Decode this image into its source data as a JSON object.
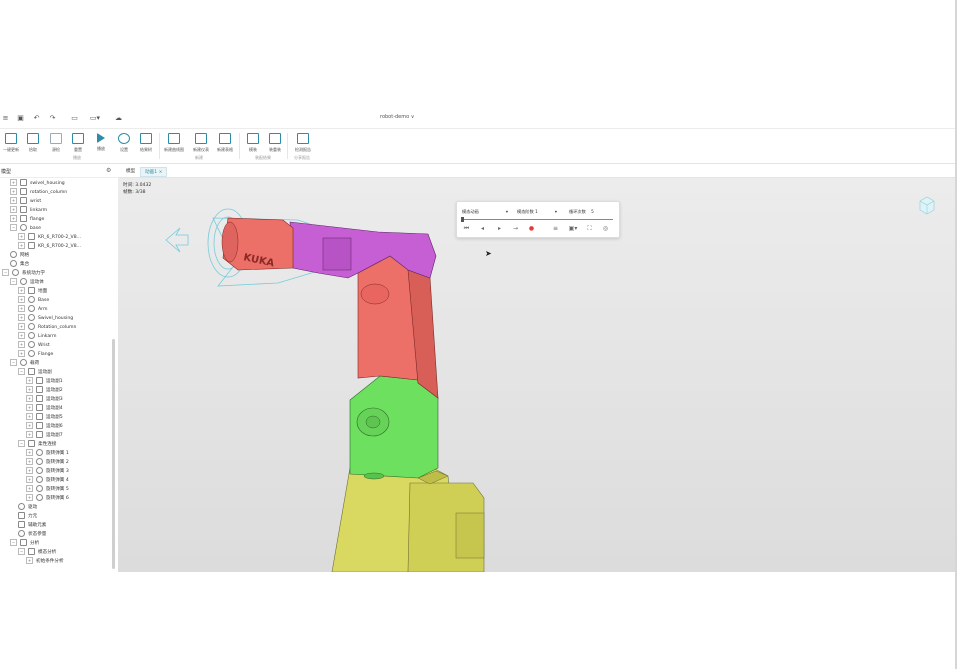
{
  "document": {
    "title": "robot-demo",
    "dropdown_icon": "chevron-down-icon"
  },
  "titlebar_icons": [
    "menu-icon",
    "save-icon",
    "undo-icon",
    "redo-icon",
    "screen-icon",
    "layout-icon",
    "cloud-icon"
  ],
  "ribbon": {
    "buttons": [
      {
        "label": "一键更新",
        "icon": "refresh-icon"
      },
      {
        "label": "拾取",
        "icon": "pick-icon"
      },
      {
        "label": "源检",
        "icon": "check-icon"
      },
      {
        "label": "重置",
        "icon": "reset-icon"
      },
      {
        "label": "播放",
        "icon": "play-icon"
      },
      {
        "label": "设置",
        "icon": "settings-icon"
      },
      {
        "label": "结果树",
        "icon": "result-tree-icon"
      },
      {
        "label": "新建曲线图",
        "icon": "line-chart-icon"
      },
      {
        "label": "新建仪表",
        "icon": "dashboard-icon"
      },
      {
        "label": "新建表格",
        "icon": "table-icon"
      },
      {
        "label": "模装",
        "icon": "assembly-icon"
      },
      {
        "label": "装重装",
        "icon": "reassemble-icon"
      },
      {
        "label": "检测报告",
        "icon": "report-icon"
      }
    ],
    "groups": [
      "播放",
      "新建",
      "装配结果",
      "分享报告"
    ]
  },
  "panel": {
    "title": "模型",
    "settings_icon": "gear-icon"
  },
  "tree": [
    "swivel_housing",
    "rotation_column",
    "wrist",
    "linkarm",
    "flange",
    "base",
    "KR_6_R700-2_V8...",
    "KR_6_R700-2_V8...",
    "网格",
    "集合",
    "系统动力学",
    "运动体",
    "地面",
    "Base",
    "Arm",
    "Swivel_housing",
    "Rotation_column",
    "Linkarm",
    "Wrist",
    "Flange",
    "载荷",
    "运动副",
    "运动副1",
    "运动副2",
    "运动副3",
    "运动副4",
    "运动副5",
    "运动副6",
    "运动副7",
    "柔性连接",
    "旋转弹簧 1",
    "旋转弹簧 2",
    "旋转弹簧 3",
    "旋转弹簧 4",
    "旋转弹簧 5",
    "旋转弹簧 6",
    "驱动",
    "力元",
    "辅助元素",
    "状态参量",
    "分析",
    "模态分析",
    "初始条件分析"
  ],
  "tabs": [
    {
      "label": "模型"
    },
    {
      "label": "动画1"
    }
  ],
  "tab_close_icon": "close-icon",
  "viewport": {
    "time_label": "时间:",
    "time_value": "3.0432",
    "frame_label": "帧数:",
    "frame_value": "3/38"
  },
  "animation_bar": {
    "mode": "模态动画",
    "order_label": "模态阶数",
    "order_value": "1",
    "loop_label": "循环次数",
    "loop_value": "5",
    "progress": 0.0
  },
  "colors": {
    "accent": "#2d8da6",
    "record": "#e23b3b",
    "link_salmon": "#ec6f68",
    "link_magenta": "#c65ed4",
    "link_green": "#6ee05f",
    "link_yellow": "#d9d860"
  }
}
